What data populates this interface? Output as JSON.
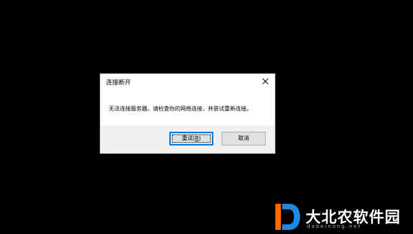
{
  "dialog": {
    "title": "连接断开",
    "message": "无法连接服务器。请检查你的网络连接，并尝试重新连接。",
    "retry_button": {
      "label": "重试(",
      "accel": "R",
      "suffix": ")"
    },
    "cancel_button": {
      "label": "取消"
    }
  },
  "watermark": {
    "site_name": "大北农软件园",
    "url": "dabeinong.net"
  },
  "colors": {
    "desktop_background": "#000000",
    "dialog_background": "#ffffff",
    "footer_background": "#f0f0f0",
    "default_button_border": "#0078d7",
    "watermark_blue": "#1e88e5",
    "watermark_orange": "#ff6a00"
  }
}
